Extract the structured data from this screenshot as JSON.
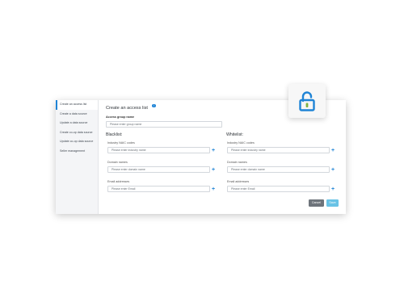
{
  "sidebar": {
    "items": [
      {
        "label": "Create an access list"
      },
      {
        "label": "Create a data source"
      },
      {
        "label": "Update a data source"
      },
      {
        "label": "Create co-op data source"
      },
      {
        "label": "Update co-op data source"
      },
      {
        "label": "Seller management"
      }
    ]
  },
  "header": {
    "title": "Create an access list",
    "info_icon": "i"
  },
  "form": {
    "group_name_label": "Access group name",
    "group_name_placeholder": "Please enter group name",
    "blacklist": {
      "title": "Blacklist:",
      "naic_label": "Industry NAIC codes",
      "naic_placeholder": "Please enter industry name",
      "domain_label": "Domain names",
      "domain_placeholder": "Please enter domain name",
      "email_label": "Email addresses",
      "email_placeholder": "Please enter Email"
    },
    "whitelist": {
      "title": "Whitelist:",
      "naic_label": "Industry NAIC codes",
      "naic_placeholder": "Please enter industry name",
      "domain_label": "Domain names",
      "domain_placeholder": "Please enter domain name",
      "email_label": "Email addresses",
      "email_placeholder": "Please enter Email"
    },
    "plus_symbol": "+",
    "cancel_label": "Cancel",
    "save_label": "Save"
  },
  "lock_card": {
    "icon": "unlock-icon"
  },
  "colors": {
    "accent": "#1f84d6",
    "save_button": "#69c3e6",
    "cancel_button": "#6e747b",
    "lock_shackle": "#1f84d6",
    "lock_keyhole": "#7cb342"
  }
}
